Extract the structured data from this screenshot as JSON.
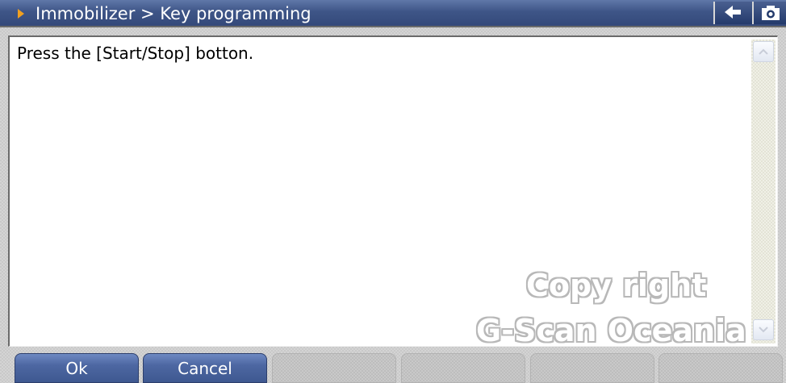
{
  "titlebar": {
    "title": "Immobilizer > Key programming"
  },
  "icons": {
    "title_arrow": "play-arrow-icon",
    "back": "back-arrow-icon",
    "camera": "camera-icon",
    "scroll_up": "chevron-up-icon",
    "scroll_down": "chevron-down-icon"
  },
  "content": {
    "message": "Press the [Start/Stop] botton."
  },
  "watermark": {
    "line1": "Copy right",
    "line2": "G-Scan Oceania"
  },
  "buttons": {
    "ok": "Ok",
    "cancel": "Cancel"
  },
  "colors": {
    "titlebar": "#3e5587",
    "accent_arrow": "#f0a020",
    "button_active": "#4d67a2"
  }
}
